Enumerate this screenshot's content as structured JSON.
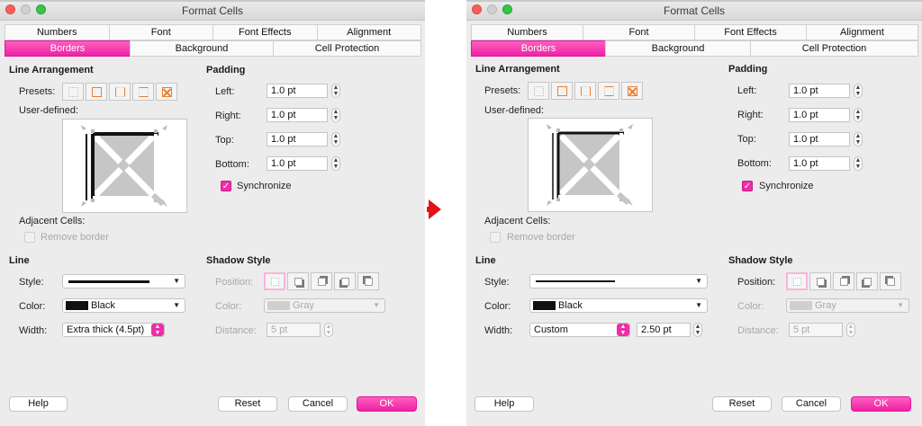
{
  "dialogs": [
    {
      "title": "Format Cells",
      "tabs_row1": [
        "Numbers",
        "Font",
        "Font Effects",
        "Alignment"
      ],
      "tabs_row2": [
        "Borders",
        "Background",
        "Cell Protection"
      ],
      "active_tab": "Borders",
      "line_arrangement": {
        "heading": "Line Arrangement",
        "presets_label": "Presets:",
        "user_defined_label": "User-defined:"
      },
      "adjacent": {
        "label": "Adjacent Cells:",
        "remove_border": "Remove border",
        "remove_border_checked": false
      },
      "line": {
        "heading": "Line",
        "style_label": "Style:",
        "color_label": "Color:",
        "color_value": "Black",
        "width_label": "Width:",
        "width_value": "Extra thick (4.5pt)",
        "width_custom": ""
      },
      "padding": {
        "heading": "Padding",
        "left_label": "Left:",
        "left": "1.0 pt",
        "right_label": "Right:",
        "right": "1.0 pt",
        "top_label": "Top:",
        "top": "1.0 pt",
        "bottom_label": "Bottom:",
        "bottom": "1.0 pt",
        "synchronize": "Synchronize",
        "synchronize_checked": true
      },
      "shadow": {
        "heading": "Shadow Style",
        "position_label": "Position:",
        "color_label": "Color:",
        "color_value": "Gray",
        "distance_label": "Distance:",
        "distance_value": "5 pt"
      },
      "buttons": {
        "help": "Help",
        "reset": "Reset",
        "cancel": "Cancel",
        "ok": "OK"
      }
    },
    {
      "title": "Format Cells",
      "tabs_row1": [
        "Numbers",
        "Font",
        "Font Effects",
        "Alignment"
      ],
      "tabs_row2": [
        "Borders",
        "Background",
        "Cell Protection"
      ],
      "active_tab": "Borders",
      "line_arrangement": {
        "heading": "Line Arrangement",
        "presets_label": "Presets:",
        "user_defined_label": "User-defined:"
      },
      "adjacent": {
        "label": "Adjacent Cells:",
        "remove_border": "Remove border",
        "remove_border_checked": false
      },
      "line": {
        "heading": "Line",
        "style_label": "Style:",
        "color_label": "Color:",
        "color_value": "Black",
        "width_label": "Width:",
        "width_value": "Custom",
        "width_custom": "2.50 pt"
      },
      "padding": {
        "heading": "Padding",
        "left_label": "Left:",
        "left": "1.0 pt",
        "right_label": "Right:",
        "right": "1.0 pt",
        "top_label": "Top:",
        "top": "1.0 pt",
        "bottom_label": "Bottom:",
        "bottom": "1.0 pt",
        "synchronize": "Synchronize",
        "synchronize_checked": true
      },
      "shadow": {
        "heading": "Shadow Style",
        "position_label": "Position:",
        "color_label": "Color:",
        "color_value": "Gray",
        "distance_label": "Distance:",
        "distance_value": "5 pt"
      },
      "buttons": {
        "help": "Help",
        "reset": "Reset",
        "cancel": "Cancel",
        "ok": "OK"
      }
    }
  ],
  "colors": {
    "accent": "#ee2da6",
    "preset_orange": "#f07c2a",
    "arrow_red": "#e3121b"
  },
  "icons": {
    "transition": "right-arrow-icon",
    "presets": [
      "no-border-icon",
      "all-borders-icon",
      "left-right-borders-icon",
      "top-bottom-borders-icon",
      "diagonal-borders-icon"
    ],
    "shadows": [
      "no-shadow-icon",
      "shadow-bottom-right-icon",
      "shadow-top-right-icon",
      "shadow-bottom-left-icon",
      "shadow-top-left-icon"
    ]
  }
}
